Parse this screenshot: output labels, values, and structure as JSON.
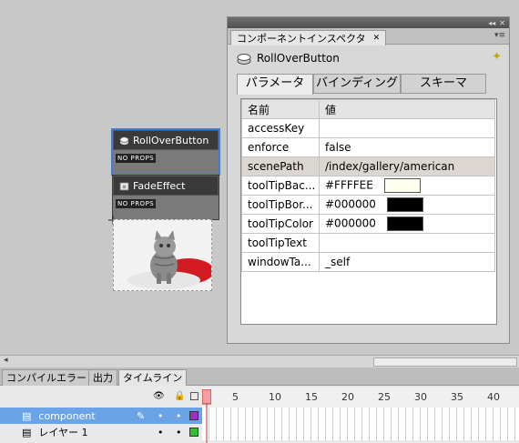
{
  "stage": {
    "components": [
      {
        "name": "RollOverButton",
        "props": "NO PROPS",
        "selected": true
      },
      {
        "name": "FadeEffect",
        "props": "NO PROPS",
        "selected": false
      }
    ]
  },
  "panel": {
    "title": "コンポーネントインスペクタ",
    "component_name": "RollOverButton",
    "tabs": [
      "パラメータ",
      "バインディング",
      "スキーマ"
    ],
    "columns": [
      "名前",
      "値"
    ],
    "rows": [
      {
        "name": "accessKey",
        "value": ""
      },
      {
        "name": "enforce",
        "value": "false"
      },
      {
        "name": "scenePath",
        "value": "/index/gallery/american"
      },
      {
        "name": "toolTipBac...",
        "value": "#FFFFEE",
        "swatch": "#FFFFEE"
      },
      {
        "name": "toolTipBor...",
        "value": "#000000",
        "swatch": "#000000"
      },
      {
        "name": "toolTipColor",
        "value": "#000000",
        "swatch": "#000000"
      },
      {
        "name": "toolTipText",
        "value": ""
      },
      {
        "name": "windowTa...",
        "value": "_self"
      }
    ]
  },
  "bottom_tabs": [
    "コンパイルエラー",
    "出力",
    "タイムライン"
  ],
  "timeline": {
    "ruler": [
      "1",
      "5",
      "10",
      "15",
      "20",
      "25",
      "30",
      "35",
      "40"
    ],
    "layers": [
      {
        "name": "component",
        "color": "#a030c0",
        "selected": true
      },
      {
        "name": "レイヤー 1",
        "color": "#30c030",
        "selected": false
      }
    ]
  },
  "colors": {
    "selection": "#6aa4e6",
    "playhead": "#e05050"
  }
}
